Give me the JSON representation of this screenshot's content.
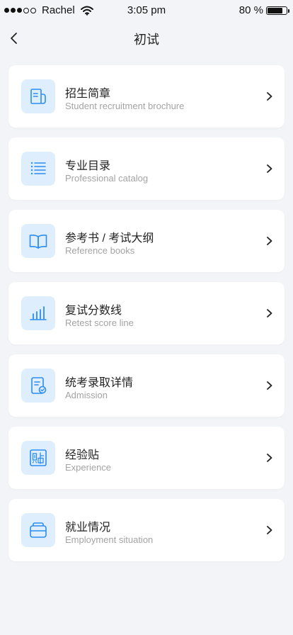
{
  "status": {
    "carrier": "Rachel",
    "time": "3:05 pm",
    "battery_text": "80 %",
    "battery_level": 0.8
  },
  "nav": {
    "title": "初试",
    "back_icon": "chevron-left-icon"
  },
  "accent": "#2b8df0",
  "items": [
    {
      "title": "招生简章",
      "subtitle": "Student recruitment brochure",
      "icon": "brochure-icon"
    },
    {
      "title": "专业目录",
      "subtitle": "Professional catalog",
      "icon": "list-icon"
    },
    {
      "title": "参考书 / 考试大纲",
      "subtitle": "Reference books",
      "icon": "book-icon"
    },
    {
      "title": "复试分数线",
      "subtitle": "Retest score line",
      "icon": "bar-chart-icon"
    },
    {
      "title": "统考录取详情",
      "subtitle": "Admission",
      "icon": "document-check-icon"
    },
    {
      "title": "经验贴",
      "subtitle": "Experience",
      "icon": "post-icon"
    },
    {
      "title": "就业情况",
      "subtitle": "Employment situation",
      "icon": "briefcase-icon"
    }
  ]
}
